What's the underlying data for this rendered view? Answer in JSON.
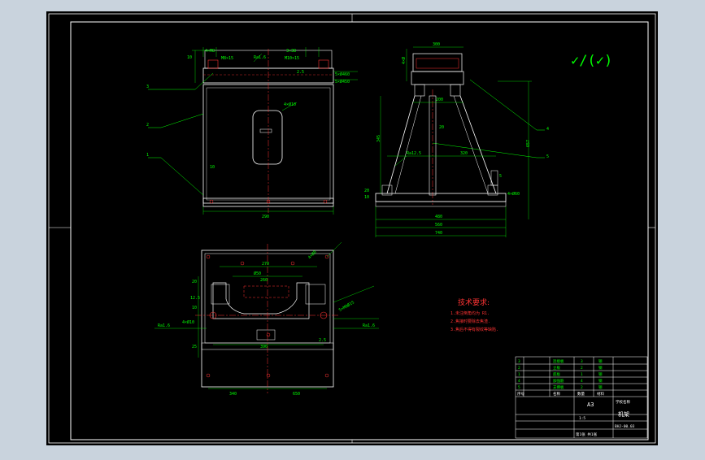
{
  "drawing": {
    "roughness_symbol": "✓/(✓)",
    "leaders": [
      "3",
      "2",
      "1",
      "4",
      "5"
    ],
    "dims_front": [
      "4×M8",
      "3×38",
      "M8×15",
      "M10×15",
      "10",
      "2.5",
      "5×Ø460",
      "5×Ø450",
      "4×Ø10",
      "10",
      "290",
      "Ra1.6"
    ],
    "dims_side": [
      "300",
      "4×Ø",
      "200",
      "20",
      "320",
      "Ra12.5",
      "5",
      "4×Ø60",
      "20",
      "10",
      "480",
      "560",
      "740",
      "345",
      "657"
    ],
    "dims_top": [
      "4×Ø8",
      "270",
      "Ø50",
      "260",
      "20",
      "12.5",
      "10",
      "25",
      "Ra1.6",
      "4×Ø10",
      "Ra1.6",
      "5×M8Ø15",
      "390",
      "2.5",
      "340",
      "650"
    ],
    "notes": {
      "title": "技术要求:",
      "items": [
        "1.未注倒角均为 R1.",
        "2.焦接时要除去焦渣.",
        "3.焦后不得有裂纹等缺陷."
      ]
    },
    "title_block": {
      "rows": [
        [
          "3",
          "连接板",
          "3",
          "钢"
        ],
        [
          "2",
          "立板",
          "2",
          "钢"
        ],
        [
          "1",
          "底板",
          "1",
          "钢"
        ],
        [
          "4",
          "加强筋",
          "4",
          "钢"
        ],
        [
          "5",
          "支撑板",
          "2",
          "钢"
        ]
      ],
      "header": [
        "序号",
        "名称",
        "数量",
        "材料"
      ],
      "sheet_size": "A3",
      "school": "学校名称",
      "part_name": "机架",
      "drawing_no": "BHJ-00.03",
      "scale": "1:5",
      "sheet": "第1张 共1张"
    }
  }
}
